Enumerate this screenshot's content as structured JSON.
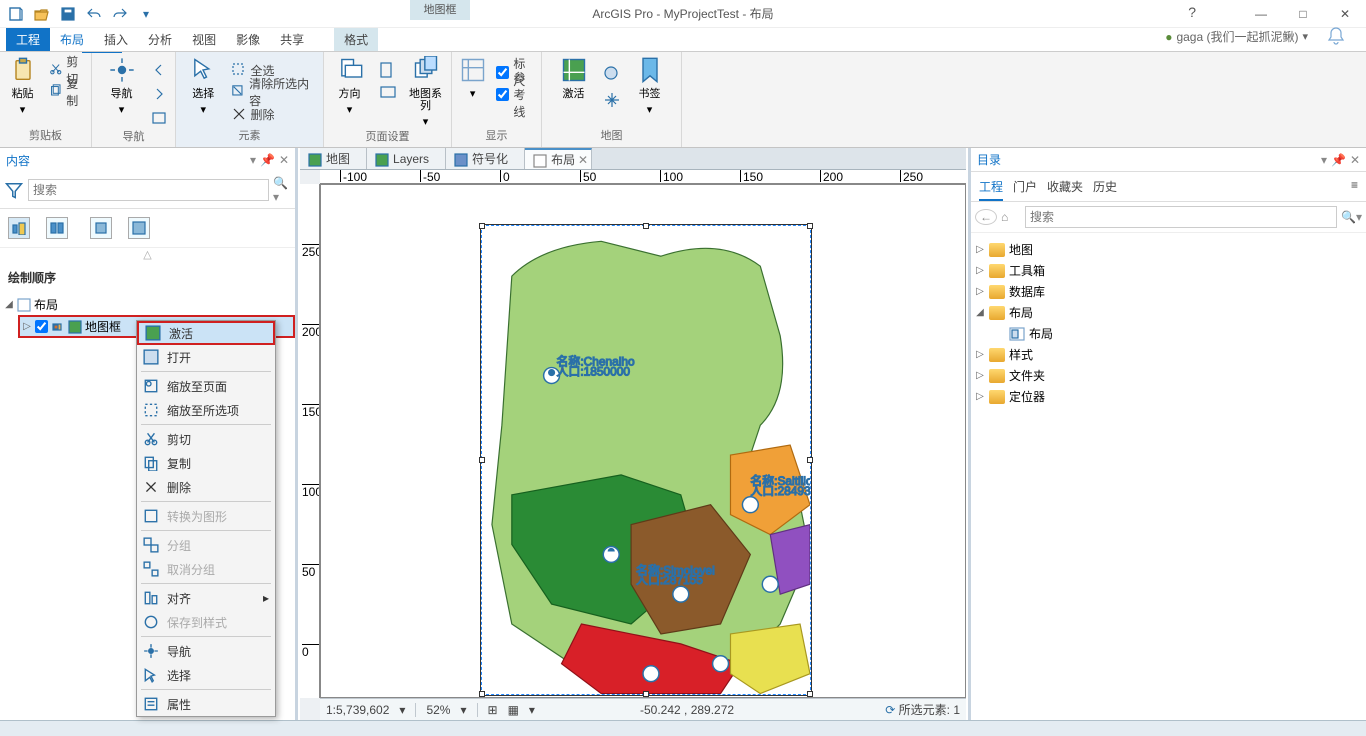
{
  "app": {
    "title": "ArcGIS Pro - MyProjectTest - 布局",
    "ctxtab": "地图框",
    "user": "gaga (我们一起抓泥鳅)"
  },
  "tabs": {
    "file": "工程",
    "layout": "布局",
    "insert": "插入",
    "analyze": "分析",
    "view": "视图",
    "image": "影像",
    "share": "共享",
    "format": "格式"
  },
  "ribbon": {
    "clipboard": {
      "paste": "粘贴",
      "cut": "剪切",
      "copy": "复制",
      "label": "剪贴板"
    },
    "nav": {
      "nav": "导航",
      "label": "导航"
    },
    "element": {
      "select": "选择",
      "all": "全选",
      "clear": "清除所选内容",
      "delete": "删除",
      "label": "元素"
    },
    "page": {
      "orient": "方向",
      "series": "地图系列",
      "label": "页面设置"
    },
    "show": {
      "ruler": "标尺",
      "guides": "参考线",
      "label": "显示"
    },
    "map": {
      "activate": "激活",
      "bookmarks": "书签",
      "label": "地图"
    }
  },
  "contents": {
    "title": "内容",
    "search": "搜索",
    "order": "绘制顺序",
    "root": "布局",
    "frame": "地图框"
  },
  "ctx": {
    "activate": "激活",
    "open": "打开",
    "zoompage": "缩放至页面",
    "zoomsel": "缩放至所选项",
    "cut": "剪切",
    "copy": "复制",
    "delete": "删除",
    "graphic": "转换为图形",
    "group": "分组",
    "ungroup": "取消分组",
    "align": "对齐",
    "savestyle": "保存到样式",
    "nav": "导航",
    "select": "选择",
    "prop": "属性"
  },
  "views": {
    "map": "地图",
    "layers": "Layers",
    "sym": "符号化",
    "layout": "布局"
  },
  "ruler": {
    "h": [
      "-100",
      "-50",
      "0",
      "50",
      "100",
      "150",
      "200",
      "250"
    ],
    "v": [
      "250",
      "200",
      "150",
      "100",
      "50",
      "0"
    ]
  },
  "status": {
    "scale": "1:5,739,602",
    "zoom": "52%",
    "coord": "-50.242 , 289.272",
    "sel": "所选元素: 1"
  },
  "catalog": {
    "title": "目录",
    "search": "搜索",
    "tabs": {
      "project": "工程",
      "portal": "门户",
      "favorites": "收藏夹",
      "history": "历史"
    },
    "items": {
      "maps": "地图",
      "toolbox": "工具箱",
      "db": "数据库",
      "layouts": "布局",
      "layoutchild": "布局",
      "styles": "样式",
      "folders": "文件夹",
      "locators": "定位器"
    }
  }
}
